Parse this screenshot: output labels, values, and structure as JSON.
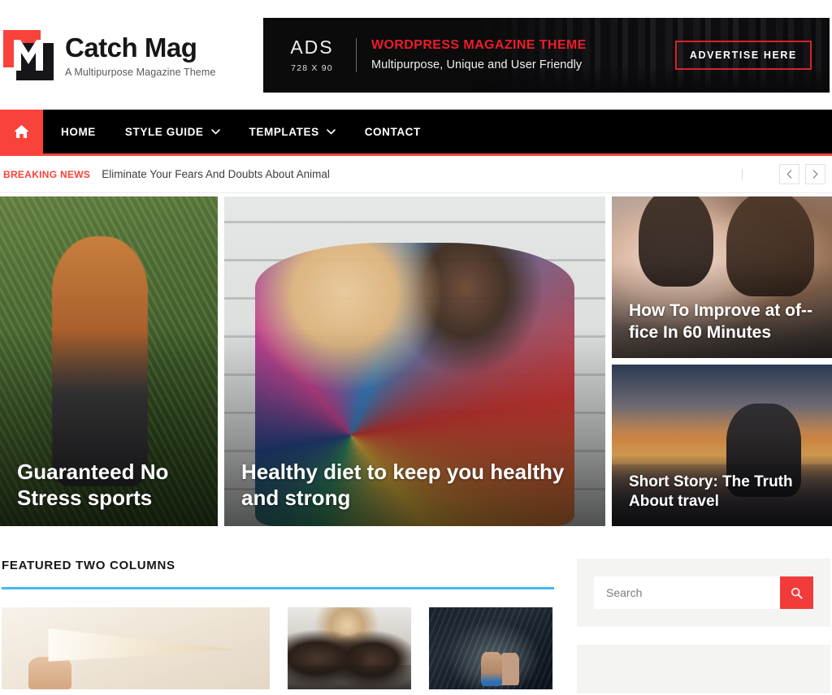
{
  "site": {
    "title": "Catch Mag",
    "tagline": "A Multipurpose Magazine Theme"
  },
  "ad": {
    "label": "ADS",
    "size": "728 X 90",
    "headline": "WORDPRESS MAGAZINE THEME",
    "subline": "Multipurpose, Unique and User Friendly",
    "cta": "ADVERTISE HERE"
  },
  "nav": {
    "home_icon": "home-icon",
    "items": [
      {
        "label": "HOME",
        "has_dropdown": false
      },
      {
        "label": "STYLE GUIDE",
        "has_dropdown": true
      },
      {
        "label": "TEMPLATES",
        "has_dropdown": true
      },
      {
        "label": "CONTACT",
        "has_dropdown": false
      }
    ]
  },
  "breaking": {
    "label": "BREAKING NEWS",
    "headline": "Eliminate Your Fears And Doubts About Animal",
    "prev_icon": "chevron-left-icon",
    "next_icon": "chevron-right-icon"
  },
  "hero": {
    "cards": [
      {
        "title": "Guaranteed No Stress sports",
        "position": "left"
      },
      {
        "title": "Healthy diet to keep you healthy and strong",
        "position": "center"
      },
      {
        "title": "How To Improve at of-­fice In 60 Minutes",
        "position": "right-top"
      },
      {
        "title": "Short Story: The Truth About travel",
        "position": "right-bottom"
      }
    ]
  },
  "featured": {
    "section_title": "FEATURED TWO COLUMNS",
    "accent_color": "#43b8f0",
    "thumbs": [
      {
        "name": "freedom-banner-photo"
      },
      {
        "name": "office-team-photo"
      },
      {
        "name": "shoes-on-rock-photo"
      }
    ]
  },
  "sidebar": {
    "search": {
      "placeholder": "Search",
      "value": "",
      "button_icon": "search-icon"
    }
  },
  "colors": {
    "brand_red": "#f9423a",
    "search_red": "#f23c3c",
    "accent_blue": "#43b8f0",
    "nav_black": "#000000"
  }
}
